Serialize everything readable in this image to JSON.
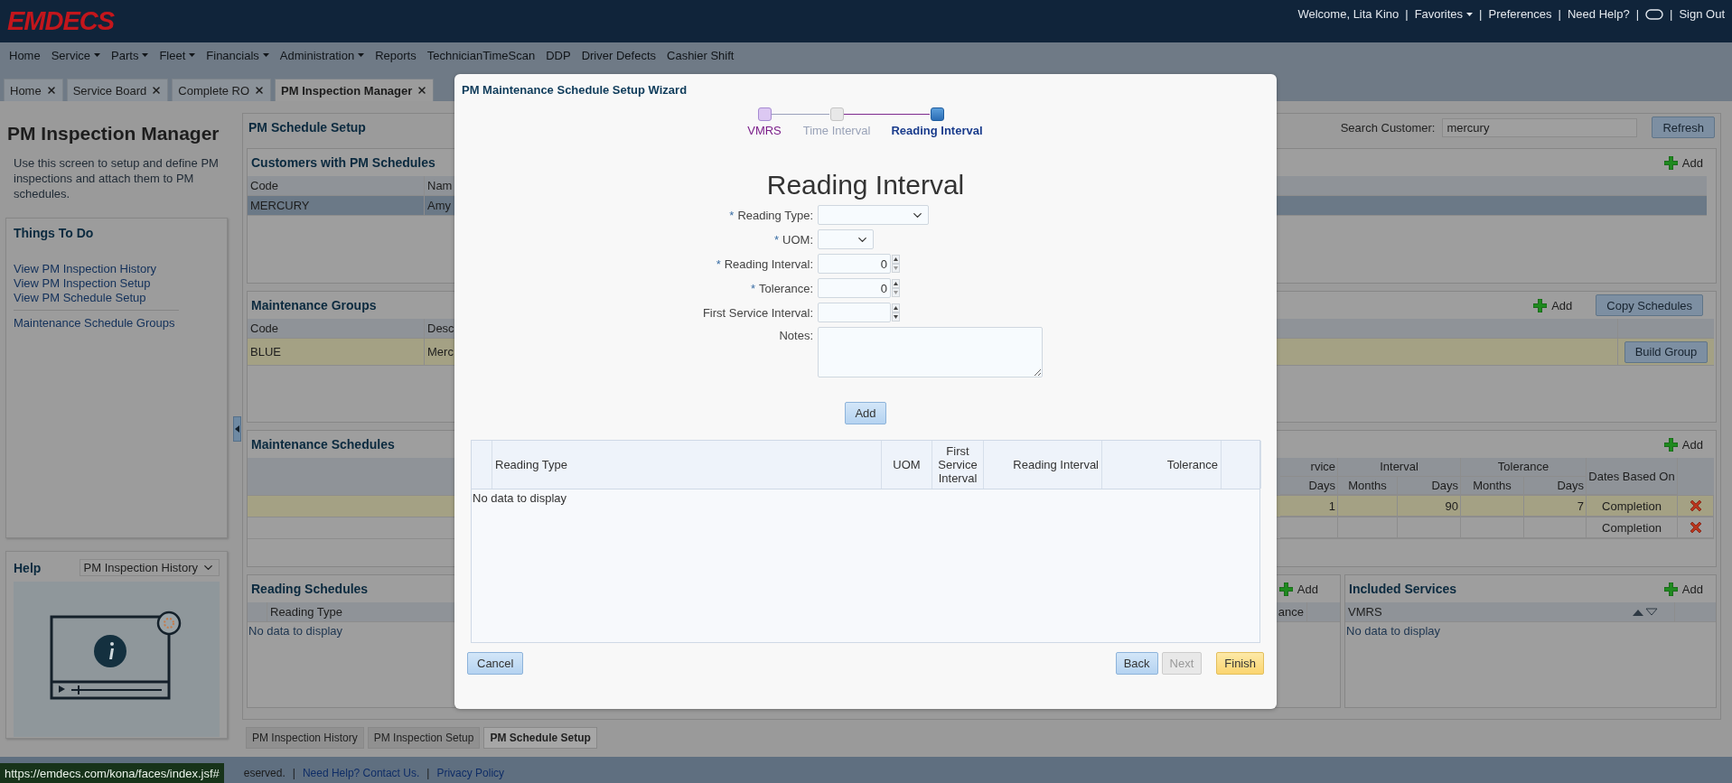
{
  "header": {
    "logo": "EMDECS",
    "items": [
      {
        "kind": "text",
        "label": "Welcome, Lita Kino"
      },
      {
        "kind": "separator",
        "label": "|"
      },
      {
        "kind": "menu",
        "label": "Favorites"
      },
      {
        "kind": "separator",
        "label": "|"
      },
      {
        "kind": "link",
        "label": "Preferences"
      },
      {
        "kind": "separator",
        "label": "|"
      },
      {
        "kind": "link",
        "label": "Need Help?"
      },
      {
        "kind": "separator",
        "label": "|"
      },
      {
        "kind": "toggle"
      },
      {
        "kind": "separator",
        "label": "|"
      },
      {
        "kind": "link",
        "label": "Sign Out"
      }
    ]
  },
  "nav": [
    {
      "label": "Home",
      "has_menu": false
    },
    {
      "label": "Service",
      "has_menu": true
    },
    {
      "label": "Parts",
      "has_menu": true
    },
    {
      "label": "Fleet",
      "has_menu": true
    },
    {
      "label": "Financials",
      "has_menu": true
    },
    {
      "label": "Administration",
      "has_menu": true
    },
    {
      "label": "Reports",
      "has_menu": false
    },
    {
      "label": "TechnicianTimeScan",
      "has_menu": false
    },
    {
      "label": "DDP",
      "has_menu": false
    },
    {
      "label": "Driver Defects",
      "has_menu": false
    },
    {
      "label": "Cashier Shift",
      "has_menu": false
    }
  ],
  "tabs": [
    {
      "label": "Home",
      "selected": false
    },
    {
      "label": "Service Board",
      "selected": false
    },
    {
      "label": "Complete RO",
      "selected": false
    },
    {
      "label": "PM Inspection Manager",
      "selected": true
    }
  ],
  "sidebar": {
    "title": "PM Inspection Manager",
    "description": "Use this screen to setup and define PM inspections and attach them to PM schedules.",
    "things_to_do": {
      "title": "Things To Do",
      "groups": [
        {
          "links": [
            "View PM Inspection History",
            "View PM Inspection Setup",
            "View PM Schedule Setup"
          ]
        },
        {
          "links": [
            "Maintenance Schedule Groups"
          ]
        }
      ]
    },
    "help": {
      "title": "Help",
      "select": "PM Inspection History"
    }
  },
  "main": {
    "title": "PM Schedule Setup",
    "search": {
      "label": "Search Customer:",
      "value": "mercury"
    },
    "refresh": "Refresh",
    "customers": {
      "title": "Customers with PM Schedules",
      "add": "Add",
      "columns": [
        "Code",
        "Nam"
      ],
      "rows": [
        {
          "cells": [
            "MERCURY",
            "Amy"
          ],
          "selected": true
        }
      ]
    },
    "groups": {
      "title": "Maintenance Groups",
      "add": "Add",
      "copy": "Copy Schedules",
      "columns": [
        "Code",
        "Desc"
      ],
      "rows": [
        {
          "cells": [
            "BLUE",
            "Merc"
          ],
          "highlighted": true,
          "action": "Build Group"
        }
      ]
    },
    "schedules": {
      "title": "Maintenance Schedules",
      "add": "Add",
      "group_headers": [
        "rvice",
        "Interval",
        "Tolerance",
        "Dates Based On"
      ],
      "sub_headers": [
        "Days",
        "Months",
        "Days",
        "Months",
        "Days"
      ],
      "rows": [
        {
          "service_days": "1",
          "interval_days": "90",
          "tolerance_days": "7",
          "based_on": "Completion",
          "highlighted": true
        },
        {
          "based_on": "Completion",
          "highlighted": false
        }
      ]
    },
    "reading_schedules": {
      "title": "Reading Schedules",
      "add": "Add",
      "columns": [
        "Reading Type",
        "ance"
      ],
      "empty": "No data to display"
    },
    "included_services": {
      "title": "Included Services",
      "add": "Add",
      "columns": [
        "VMRS"
      ],
      "empty": "No data to display"
    }
  },
  "bottom_tabs": [
    {
      "label": "PM Inspection History",
      "selected": false
    },
    {
      "label": "PM Inspection Setup",
      "selected": false
    },
    {
      "label": "PM Schedule Setup",
      "selected": true
    }
  ],
  "footer": {
    "status_url": "https://emdecs.com/kona/faces/index.jsf#",
    "items": [
      {
        "kind": "text",
        "label": "eserved."
      },
      {
        "kind": "separator",
        "label": "|"
      },
      {
        "kind": "link",
        "label": "Need Help? Contact Us."
      },
      {
        "kind": "separator",
        "label": "|"
      },
      {
        "kind": "link",
        "label": "Privacy Policy"
      }
    ]
  },
  "wizard": {
    "title": "PM Maintenance Schedule Setup Wizard",
    "steps": [
      {
        "label": "VMRS",
        "visited": true,
        "selected": false
      },
      {
        "label": "Time Interval",
        "visited": false,
        "selected": false
      },
      {
        "label": "Reading Interval",
        "selected": true
      }
    ],
    "heading": "Reading Interval",
    "fields": [
      {
        "label": "Reading Type:",
        "mark": "*",
        "kind": "select"
      },
      {
        "label": "UOM:",
        "mark": "*",
        "kind": "unit"
      },
      {
        "label": "Reading Interval:",
        "mark": "*",
        "kind": "number",
        "value": "0"
      },
      {
        "label": "Tolerance:",
        "mark": "*",
        "kind": "number",
        "value": "0"
      },
      {
        "label": "First Service Interval:",
        "kind": "number"
      },
      {
        "label": "Notes:",
        "kind": "textarea"
      }
    ],
    "add_button": "Add",
    "table": {
      "columns": [
        "Reading Type",
        "UOM",
        "First Service Interval",
        "Reading Interval",
        "Tolerance"
      ],
      "empty": "No data to display"
    },
    "buttons": [
      {
        "label": "Cancel",
        "kind": "secondary",
        "disabled": false
      },
      {
        "label": "Back",
        "kind": "secondary",
        "disabled": false
      },
      {
        "label": "Next",
        "kind": "secondary",
        "disabled": true
      },
      {
        "label": "Finish",
        "kind": "primary",
        "disabled": false
      }
    ]
  }
}
